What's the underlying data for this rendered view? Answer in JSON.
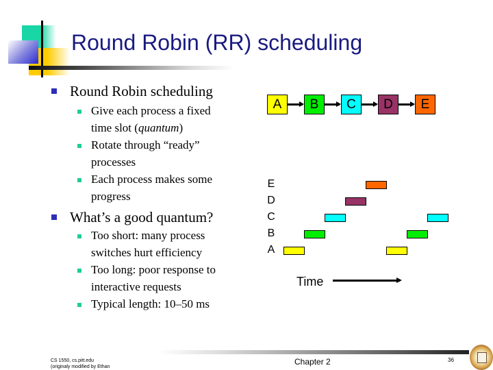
{
  "slide": {
    "title": "Round Robin (RR) scheduling",
    "bullets": [
      {
        "text": "Round Robin scheduling",
        "sub": [
          {
            "lines": [
              "Give each process a fixed",
              "time slot ("
            ],
            "italic": "quantum",
            "after": ")"
          },
          {
            "lines": [
              "Rotate through “ready”",
              "processes"
            ]
          },
          {
            "lines": [
              "Each process makes some",
              "progress"
            ]
          }
        ]
      },
      {
        "text": "What’s a good quantum?",
        "sub": [
          {
            "lines": [
              "Too short: many process",
              "switches hurt efficiency"
            ]
          },
          {
            "lines": [
              "Too long: poor response to",
              "interactive requests"
            ]
          },
          {
            "lines": [
              "Typical length: 10–50 ms"
            ]
          }
        ]
      }
    ]
  },
  "diagram": {
    "queue": [
      {
        "label": "A",
        "color": "#ffff00"
      },
      {
        "label": "B",
        "color": "#00ee00"
      },
      {
        "label": "C",
        "color": "#00ffff"
      },
      {
        "label": "D",
        "color": "#993366"
      },
      {
        "label": "E",
        "color": "#ff6600"
      }
    ],
    "row_labels_top_to_bottom": [
      "E",
      "D",
      "C",
      "B",
      "A"
    ],
    "schedule": [
      {
        "process": "A",
        "slot": 0
      },
      {
        "process": "B",
        "slot": 1
      },
      {
        "process": "C",
        "slot": 2
      },
      {
        "process": "D",
        "slot": 3
      },
      {
        "process": "E",
        "slot": 4
      },
      {
        "process": "A",
        "slot": 5
      },
      {
        "process": "B",
        "slot": 6
      },
      {
        "process": "C",
        "slot": 7
      }
    ],
    "time_label": "Time"
  },
  "footer": {
    "left_line1": "CS 1550, cs.pitt.edu",
    "left_line2": "(originaly modified by Ethan",
    "center": "Chapter 2",
    "page": "36"
  }
}
